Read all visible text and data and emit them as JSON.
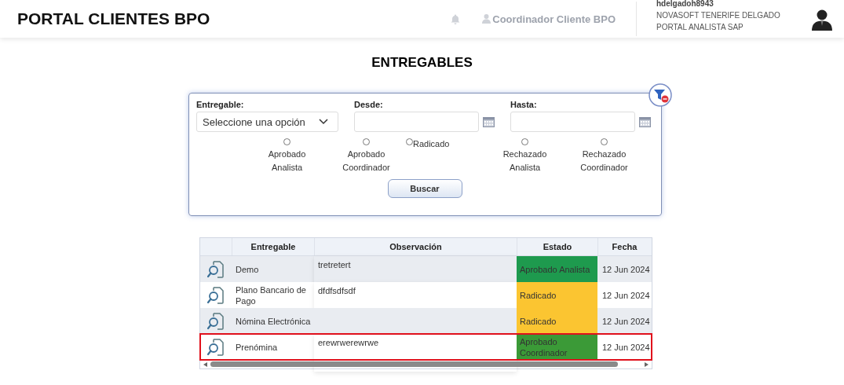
{
  "header": {
    "title": "PORTAL CLIENTES BPO",
    "role": "Coordinador Cliente BPO",
    "username": "hdelgadoh8943",
    "user_detail": "NOVASOFT TENERIFE DELGADO PORTAL ANALISTA SAP"
  },
  "page_title": "ENTREGABLES",
  "filters": {
    "entregable": {
      "label": "Entregable:",
      "value": "Seleccione una opción"
    },
    "desde": {
      "label": "Desde:"
    },
    "hasta": {
      "label": "Hasta:"
    },
    "states": [
      {
        "label": "Aprobado Analista",
        "selected": false,
        "inline": false
      },
      {
        "label": "Aprobado Coordinador",
        "selected": false,
        "inline": false
      },
      {
        "label": "Radicado",
        "selected": false,
        "inline": true
      },
      {
        "label": "Rechazado Analista",
        "selected": false,
        "inline": false
      },
      {
        "label": "Rechazado Coordinador",
        "selected": false,
        "inline": false
      }
    ],
    "search_button": "Buscar"
  },
  "table": {
    "columns": [
      "Entregable",
      "Observación",
      "Estado",
      "Fecha"
    ],
    "rows": [
      {
        "entregable": "Demo",
        "observacion": "tretretert",
        "estado": "Aprobado Analista",
        "color": "#1e9a4e",
        "fecha": "12 Jun 2024",
        "highlighted": false
      },
      {
        "entregable": "Plano Bancario de Pago",
        "observacion": "dfdfsdfsdf",
        "estado": "Radicado",
        "color": "#fbc531",
        "fecha": "12 Jun 2024",
        "highlighted": false
      },
      {
        "entregable": "Nómina Electrónica",
        "observacion": "",
        "estado": "Radicado",
        "color": "#fbc531",
        "fecha": "12 Jun 2024",
        "highlighted": false
      },
      {
        "entregable": "Prenómina",
        "observacion": "erewrwerewrwe",
        "estado": "Aprobado Coordinador",
        "color": "#3b9a37",
        "fecha": "12 Jun 2024",
        "highlighted": true
      }
    ]
  }
}
